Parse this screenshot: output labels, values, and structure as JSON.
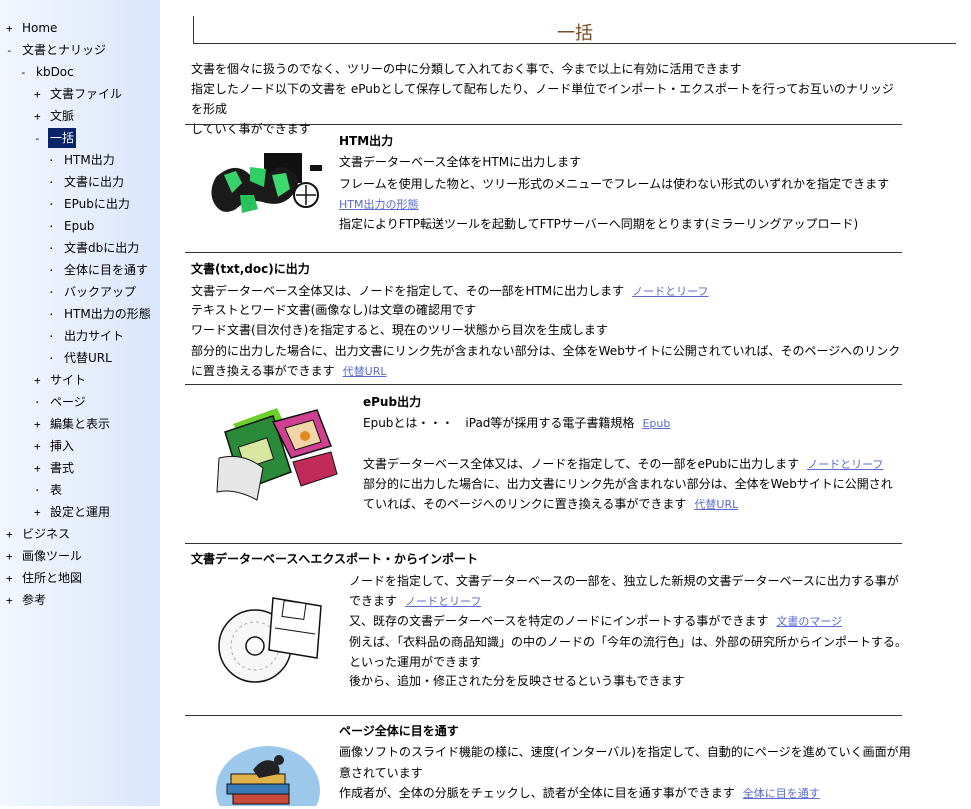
{
  "sidebar": {
    "items": [
      {
        "marker": "+",
        "label": "Home"
      },
      {
        "marker": "-",
        "label": "文書とナリッジ"
      },
      {
        "marker": "-",
        "label": "kbDoc"
      },
      {
        "marker": "+",
        "label": "文書ファイル"
      },
      {
        "marker": "+",
        "label": "文脈"
      },
      {
        "marker": "-",
        "label": "一括"
      },
      {
        "marker": "·",
        "label": "HTM出力"
      },
      {
        "marker": "·",
        "label": "文書に出力"
      },
      {
        "marker": "·",
        "label": "EPubに出力"
      },
      {
        "marker": "·",
        "label": "Epub"
      },
      {
        "marker": "·",
        "label": "文書dbに出力"
      },
      {
        "marker": "·",
        "label": "全体に目を通す"
      },
      {
        "marker": "·",
        "label": "バックアップ"
      },
      {
        "marker": "·",
        "label": "HTM出力の形態"
      },
      {
        "marker": "·",
        "label": "出力サイト"
      },
      {
        "marker": "·",
        "label": "代替URL"
      },
      {
        "marker": "+",
        "label": "サイト"
      },
      {
        "marker": "·",
        "label": "ページ"
      },
      {
        "marker": "+",
        "label": "編集と表示"
      },
      {
        "marker": "+",
        "label": "挿入"
      },
      {
        "marker": "+",
        "label": "書式"
      },
      {
        "marker": "·",
        "label": "表"
      },
      {
        "marker": "+",
        "label": "設定と運用"
      },
      {
        "marker": "+",
        "label": "ビジネス"
      },
      {
        "marker": "+",
        "label": "画像ツール"
      },
      {
        "marker": "+",
        "label": "住所と地図"
      },
      {
        "marker": "+",
        "label": "参考"
      }
    ]
  },
  "page": {
    "title": "一括",
    "intro": [
      "文書を個々に扱うのでなく、ツリーの中に分類して入れておく事で、今まで以上に有効に活用できます",
      "指定したノード以下の文書を ePubとして保存して配布したり、ノード単位でインポート・エクスポートを行ってお互いのナリッジを形成",
      "していく事ができます"
    ]
  },
  "sections": {
    "htm": {
      "title": "HTM出力",
      "l1": "文書データーベース全体をHTMに出力します",
      "l2": "フレームを使用した物と、ツリー形式のメニューでフレームは使わない形式のいずれかを指定できます",
      "link": "HTM出力の形態",
      "l3": "指定によりFTP転送ツールを起動してFTPサーバーへ同期をとります(ミラーリングアップロード)"
    },
    "doc": {
      "title": "文書(txt,doc)に出力",
      "l1": "文書データーベース全体又は、ノードを指定して、その一部をHTMに出力します",
      "l1_link": "ノードとリーフ",
      "l2": "テキストとワード文書(画像なし)は文章の確認用です",
      "l3": "ワード文書(目次付き)を指定すると、現在のツリー状態から目次を生成します",
      "l4": "部分的に出力した場合に、出力文書にリンク先が含まれない部分は、全体をWebサイトに公開されていれば、そのページへのリンク",
      "l5": "に置き換える事ができます",
      "l5_link": "代替URL"
    },
    "epub": {
      "title": "ePub出力",
      "l1": "Epubとは・・・　iPad等が採用する電子書籍規格",
      "l1_link": "Epub",
      "l2": "文書データーベース全体又は、ノードを指定して、その一部をePubに出力します",
      "l2_link": "ノードとリーフ",
      "l3": "部分的に出力した場合に、出力文書にリンク先が含まれない部分は、全体をWebサイトに公開され",
      "l4": "ていれば、そのページへのリンクに置き換える事ができます",
      "l4_link": "代替URL"
    },
    "export": {
      "title": "文書データーベースへエクスポート・からインポート",
      "l1": "ノードを指定して、文書データーベースの一部を、独立した新規の文書データーベースに出力する事が",
      "l2": "できます",
      "l2_link": "ノードとリーフ",
      "l3": "又、既存の文書データーベースを特定のノードにインポートする事ができます",
      "l3_link": "文書のマージ",
      "l4": "例えば、「衣料品の商品知識」の中のノードの「今年の流行色」は、外部の研究所からインポートする。",
      "l5": "といった運用ができます",
      "l6": "後から、追加・修正された分を反映させるという事もできます"
    },
    "review": {
      "title": "ページ全体に目を通す",
      "l1": "画像ソフトのスライド機能の様に、速度(インターバル)を指定して、自動的にページを進めていく画面が用",
      "l2": "意されています",
      "l3": "作成者が、全体の分脈をチェックし、読者が全体に目を通す事ができます",
      "l3_link": "全体に目を通す"
    }
  },
  "colors": {
    "title": "#7a4a1c",
    "link": "#5a6ad0",
    "selected_bg": "#0a246a",
    "sidebar": "#e6eefc"
  }
}
